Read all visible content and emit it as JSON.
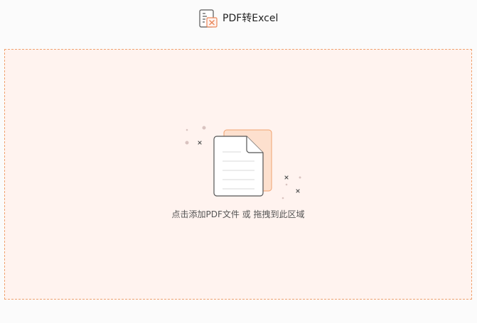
{
  "header": {
    "title": "PDF转Excel",
    "title_icon": "pdf-to-excel-icon",
    "accent_color": "#e9875a"
  },
  "drop_zone": {
    "hint_text": "点击添加PDF文件 或 拖拽到此区域",
    "illustration_icon": "document-upload-icon",
    "border_color": "#f0a26f",
    "background_color": "#fff3ef"
  }
}
